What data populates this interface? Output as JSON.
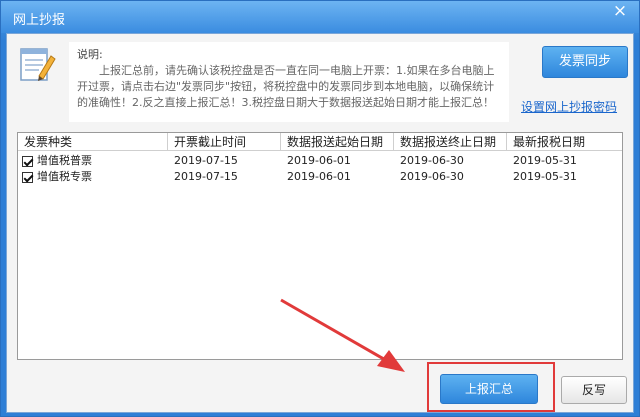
{
  "window": {
    "title": "网上抄报",
    "close_glyph": "×"
  },
  "info": {
    "icon": "notepad-pencil-icon",
    "heading": "说明:",
    "text": "上报汇总前，请先确认该税控盘是否一直在同一电脑上开票：1.如果在多台电脑上开过票，请点击右边\"发票同步\"按钮，将税控盘中的发票同步到本地电脑，以确保统计的准确性！2.反之直接上报汇总！3.税控盘日期大于数据报送起始日期才能上报汇总！"
  },
  "actions": {
    "sync_label": "发票同步",
    "password_link": "设置网上抄报密码",
    "submit_label": "上报汇总",
    "reverse_label": "反写"
  },
  "table": {
    "columns": [
      "发票种类",
      "开票截止时间",
      "数据报送起始日期",
      "数据报送终止日期",
      "最新报税日期"
    ],
    "rows": [
      {
        "checked": true,
        "cells": [
          "增值税普票",
          "2019-07-15",
          "2019-06-01",
          "2019-06-30",
          "2019-05-31"
        ]
      },
      {
        "checked": true,
        "cells": [
          "增值税专票",
          "2019-07-15",
          "2019-06-01",
          "2019-06-30",
          "2019-05-31"
        ]
      }
    ]
  },
  "colors": {
    "titlebar": "#3a8ce0",
    "button_blue": "#2e86dc",
    "highlight_red": "#e13a3a",
    "link": "#1a66cc"
  }
}
